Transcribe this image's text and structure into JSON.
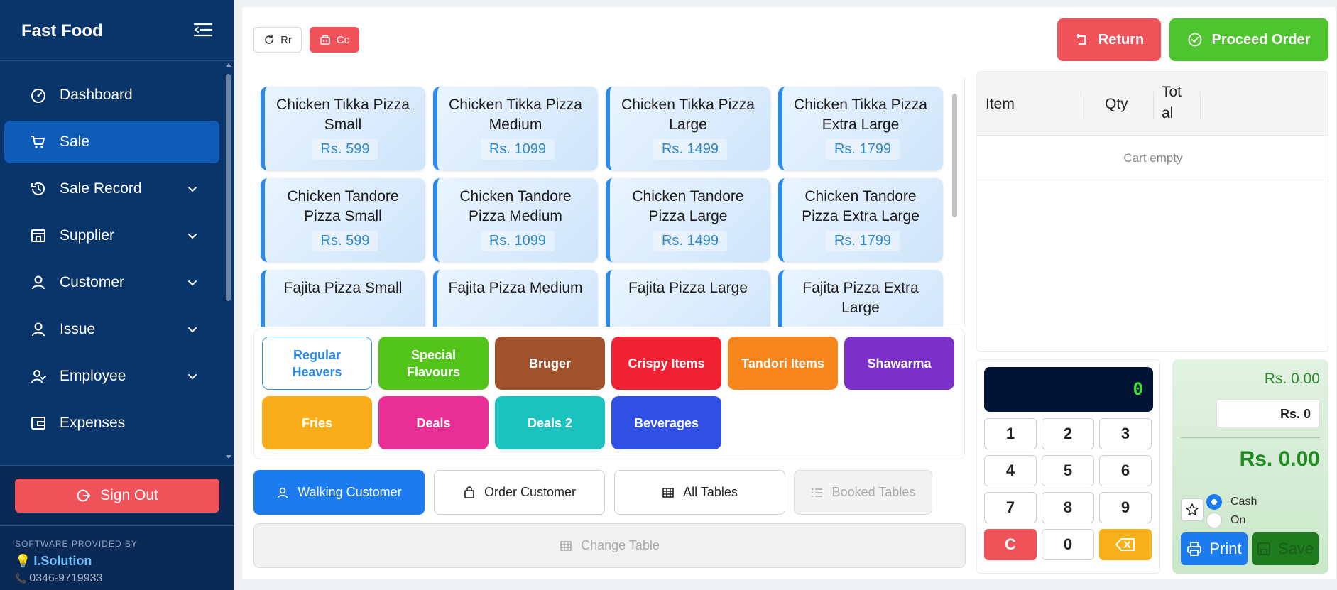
{
  "app": {
    "title": "Fast Food"
  },
  "sidebar": {
    "items": [
      {
        "label": "Dashboard",
        "icon": "gauge-icon",
        "active": false,
        "has_submenu": false
      },
      {
        "label": "Sale",
        "icon": "cart-icon",
        "active": true,
        "has_submenu": false
      },
      {
        "label": "Sale Record",
        "icon": "history-icon",
        "active": false,
        "has_submenu": true
      },
      {
        "label": "Supplier",
        "icon": "store-icon",
        "active": false,
        "has_submenu": true
      },
      {
        "label": "Customer",
        "icon": "user-icon",
        "active": false,
        "has_submenu": true
      },
      {
        "label": "Issue",
        "icon": "user-icon",
        "active": false,
        "has_submenu": true
      },
      {
        "label": "Employee",
        "icon": "users-icon",
        "active": false,
        "has_submenu": true
      },
      {
        "label": "Expenses",
        "icon": "wallet-icon",
        "active": false,
        "has_submenu": false
      }
    ],
    "signout_label": "Sign Out",
    "provided_by": "SOFTWARE PROVIDED BY",
    "company": "I.Solution",
    "phone": "0346-9719933"
  },
  "toolbar": {
    "refresh_label": "Rr",
    "clear_cart_label": "Cc",
    "return_label": "Return",
    "proceed_label": "Proceed Order"
  },
  "products": [
    {
      "name": "Chicken Tikka Pizza Small",
      "price": "Rs. 599"
    },
    {
      "name": "Chicken Tikka Pizza Medium",
      "price": "Rs. 1099"
    },
    {
      "name": "Chicken Tikka Pizza Large",
      "price": "Rs. 1499"
    },
    {
      "name": "Chicken Tikka Pizza Extra Large",
      "price": "Rs. 1799"
    },
    {
      "name": "Chicken Tandore Pizza Small",
      "price": "Rs. 599"
    },
    {
      "name": "Chicken Tandore Pizza Medium",
      "price": "Rs. 1099"
    },
    {
      "name": "Chicken Tandore Pizza Large",
      "price": "Rs. 1499"
    },
    {
      "name": "Chicken Tandore Pizza Extra Large",
      "price": "Rs. 1799"
    },
    {
      "name": "Fajita Pizza Small",
      "price": ""
    },
    {
      "name": "Fajita Pizza Medium",
      "price": ""
    },
    {
      "name": "Fajita Pizza Large",
      "price": ""
    },
    {
      "name": "Fajita Pizza Extra Large",
      "price": ""
    }
  ],
  "categories": [
    {
      "label": "Regular Heavers",
      "color": "#ffffff",
      "selected": true
    },
    {
      "label": "Special Flavours",
      "color": "#52c41a"
    },
    {
      "label": "Bruger",
      "color": "#a0522d"
    },
    {
      "label": "Crispy Items",
      "color": "#ee2233"
    },
    {
      "label": "Tandori Items",
      "color": "#f7861c"
    },
    {
      "label": "Shawarma",
      "color": "#7b2fc9"
    },
    {
      "label": "Fries",
      "color": "#f9ad1a"
    },
    {
      "label": "Deals",
      "color": "#e82f96"
    },
    {
      "label": "Deals 2",
      "color": "#1cc2bd"
    },
    {
      "label": "Beverages",
      "color": "#2f50e2"
    }
  ],
  "customer_buttons": {
    "walking": "Walking Customer",
    "order": "Order Customer",
    "all_tables": "All Tables",
    "booked_tables": "Booked Tables",
    "change_table": "Change Table"
  },
  "cart": {
    "headers": {
      "item": "Item",
      "qty": "Qty",
      "total": "Total"
    },
    "empty_text": "Cart empty"
  },
  "keypad": {
    "display": "0",
    "keys": [
      "1",
      "2",
      "3",
      "4",
      "5",
      "6",
      "7",
      "8",
      "9",
      "C",
      "0",
      "backspace"
    ]
  },
  "totals": {
    "subtotal": "Rs. 0.00",
    "discount": "Rs. 0",
    "grand_total": "Rs. 0.00",
    "payment_options": [
      "Cash",
      "On"
    ],
    "selected_payment": "Cash",
    "print_label": "Print",
    "save_label": "Save"
  },
  "colors": {
    "sidebar": "#0a356b",
    "accent": "#1d7bf0",
    "danger": "#f0525a",
    "success": "#4ec52f"
  }
}
